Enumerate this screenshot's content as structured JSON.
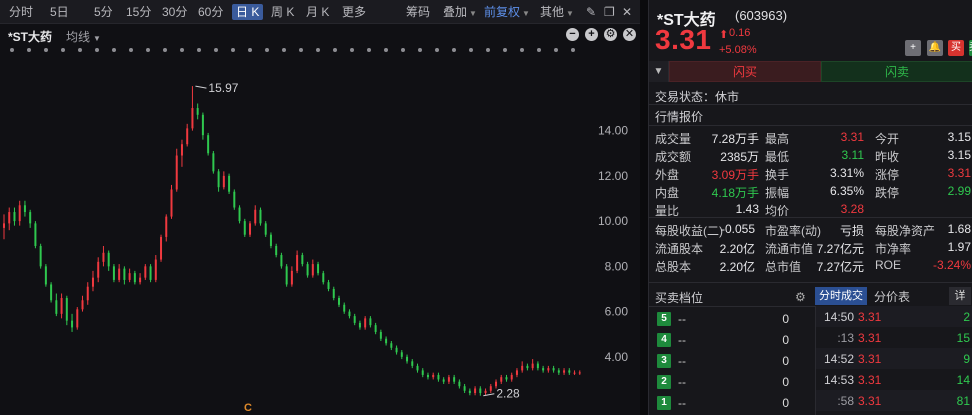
{
  "toolbar": {
    "periods": [
      "分时",
      "5日",
      "5分",
      "15分",
      "30分",
      "60分",
      "日 K",
      "周 K",
      "月 K",
      "更多"
    ],
    "active_period": "日 K",
    "tools": [
      "筹码",
      "叠加",
      "前复权",
      "其他"
    ]
  },
  "chart_header": {
    "title": "*ST大药",
    "ma_select": "均线"
  },
  "chart_data": {
    "type": "candlestick",
    "y_ticks": [
      "14.00",
      "12.00",
      "10.00",
      "8.00",
      "6.00",
      "4.00"
    ],
    "annotations": {
      "high": "15.97",
      "low": "2.28",
      "marker": "C"
    },
    "x_range": [
      0,
      111
    ],
    "ylim": [
      1.87,
      17.3
    ],
    "candles": [
      [
        9.7,
        9.9,
        10.3,
        9.2
      ],
      [
        9.9,
        10.4,
        10.6,
        9.6
      ],
      [
        10.4,
        10.0,
        10.6,
        9.8
      ],
      [
        10.0,
        10.7,
        10.9,
        9.8
      ],
      [
        10.7,
        10.4,
        10.9,
        10.2
      ],
      [
        10.4,
        9.9,
        10.5,
        9.7
      ],
      [
        9.9,
        8.9,
        10.0,
        8.8
      ],
      [
        8.9,
        8.0,
        9.0,
        7.9
      ],
      [
        8.0,
        7.2,
        8.1,
        7.1
      ],
      [
        7.2,
        6.5,
        7.3,
        6.4
      ],
      [
        6.5,
        5.9,
        6.8,
        5.8
      ],
      [
        5.9,
        6.6,
        6.8,
        5.7
      ],
      [
        6.6,
        5.6,
        6.7,
        5.4
      ],
      [
        5.6,
        5.3,
        5.9,
        5.1
      ],
      [
        5.3,
        6.1,
        6.2,
        5.2
      ],
      [
        6.1,
        6.5,
        6.7,
        6.0
      ],
      [
        6.5,
        7.1,
        7.3,
        6.3
      ],
      [
        7.1,
        7.5,
        7.8,
        6.9
      ],
      [
        7.5,
        8.2,
        8.4,
        7.3
      ],
      [
        8.2,
        8.6,
        8.9,
        8.0
      ],
      [
        8.6,
        8.0,
        8.7,
        7.8
      ],
      [
        8.0,
        7.4,
        8.1,
        7.3
      ],
      [
        7.4,
        7.9,
        8.1,
        7.3
      ],
      [
        7.9,
        7.4,
        8.0,
        7.2
      ],
      [
        7.4,
        7.7,
        7.9,
        7.3
      ],
      [
        7.7,
        7.3,
        7.8,
        7.2
      ],
      [
        7.3,
        7.5,
        7.7,
        7.2
      ],
      [
        7.5,
        8.0,
        8.1,
        7.4
      ],
      [
        8.0,
        7.4,
        8.1,
        7.3
      ],
      [
        7.4,
        8.3,
        8.5,
        7.3
      ],
      [
        8.3,
        9.3,
        9.4,
        8.2
      ],
      [
        9.3,
        10.2,
        10.3,
        9.1
      ],
      [
        10.2,
        11.4,
        11.6,
        10.1
      ],
      [
        11.4,
        12.9,
        13.2,
        11.3
      ],
      [
        12.9,
        13.4,
        13.6,
        12.4
      ],
      [
        13.4,
        14.1,
        14.3,
        13.3
      ],
      [
        14.1,
        15.0,
        15.97,
        14.0
      ],
      [
        15.0,
        14.7,
        15.2,
        14.5
      ],
      [
        14.7,
        13.8,
        14.8,
        13.6
      ],
      [
        13.8,
        13.0,
        13.9,
        12.9
      ],
      [
        13.0,
        12.2,
        13.1,
        12.1
      ],
      [
        12.2,
        11.5,
        12.3,
        11.3
      ],
      [
        11.5,
        12.0,
        12.2,
        11.4
      ],
      [
        12.0,
        11.3,
        12.1,
        11.2
      ],
      [
        11.3,
        10.6,
        11.4,
        10.5
      ],
      [
        10.6,
        10.0,
        10.7,
        9.9
      ],
      [
        10.0,
        9.4,
        10.1,
        9.3
      ],
      [
        9.4,
        9.9,
        10.0,
        9.3
      ],
      [
        9.9,
        10.5,
        10.7,
        9.8
      ],
      [
        10.5,
        9.9,
        10.6,
        9.8
      ],
      [
        9.9,
        9.4,
        10.0,
        9.3
      ],
      [
        9.4,
        8.9,
        9.5,
        8.8
      ],
      [
        8.9,
        8.5,
        9.0,
        8.4
      ],
      [
        8.5,
        8.0,
        8.6,
        7.9
      ],
      [
        8.0,
        7.2,
        8.1,
        7.1
      ],
      [
        7.2,
        7.8,
        8.0,
        7.1
      ],
      [
        7.8,
        8.5,
        8.7,
        7.7
      ],
      [
        8.5,
        8.1,
        8.6,
        8.0
      ],
      [
        8.1,
        7.6,
        8.2,
        7.5
      ],
      [
        7.6,
        8.1,
        8.3,
        7.5
      ],
      [
        8.1,
        7.7,
        8.2,
        7.6
      ],
      [
        7.7,
        7.3,
        7.8,
        7.2
      ],
      [
        7.3,
        7.0,
        7.4,
        6.9
      ],
      [
        7.0,
        6.6,
        7.1,
        6.5
      ],
      [
        6.6,
        6.3,
        6.7,
        6.2
      ],
      [
        6.3,
        6.0,
        6.4,
        5.9
      ],
      [
        6.0,
        5.8,
        6.1,
        5.7
      ],
      [
        5.8,
        5.5,
        5.9,
        5.4
      ],
      [
        5.5,
        5.3,
        5.6,
        5.2
      ],
      [
        5.3,
        5.7,
        5.8,
        5.2
      ],
      [
        5.7,
        5.4,
        5.8,
        5.3
      ],
      [
        5.4,
        5.1,
        5.5,
        5.0
      ],
      [
        5.1,
        4.8,
        5.2,
        4.7
      ],
      [
        4.8,
        4.6,
        4.9,
        4.5
      ],
      [
        4.6,
        4.4,
        4.7,
        4.3
      ],
      [
        4.4,
        4.2,
        4.5,
        4.1
      ],
      [
        4.2,
        4.0,
        4.3,
        3.9
      ],
      [
        4.0,
        3.8,
        4.1,
        3.7
      ],
      [
        3.8,
        3.6,
        3.9,
        3.5
      ],
      [
        3.6,
        3.4,
        3.7,
        3.3
      ],
      [
        3.4,
        3.2,
        3.5,
        3.1
      ],
      [
        3.2,
        3.1,
        3.3,
        3.0
      ],
      [
        3.1,
        3.2,
        3.3,
        3.0
      ],
      [
        3.2,
        3.0,
        3.3,
        2.9
      ],
      [
        3.0,
        2.9,
        3.1,
        2.8
      ],
      [
        2.9,
        3.1,
        3.2,
        2.8
      ],
      [
        3.1,
        2.9,
        3.2,
        2.8
      ],
      [
        2.9,
        2.7,
        3.0,
        2.6
      ],
      [
        2.7,
        2.5,
        2.8,
        2.4
      ],
      [
        2.5,
        2.4,
        2.6,
        2.3
      ],
      [
        2.4,
        2.6,
        2.7,
        2.3
      ],
      [
        2.6,
        2.4,
        2.7,
        2.28
      ],
      [
        2.4,
        2.5,
        2.6,
        2.3
      ],
      [
        2.5,
        2.7,
        2.8,
        2.4
      ],
      [
        2.7,
        2.9,
        3.0,
        2.6
      ],
      [
        2.9,
        3.1,
        3.2,
        2.8
      ],
      [
        3.1,
        3.0,
        3.2,
        2.9
      ],
      [
        3.0,
        3.2,
        3.3,
        2.9
      ],
      [
        3.2,
        3.4,
        3.5,
        3.1
      ],
      [
        3.4,
        3.6,
        3.8,
        3.3
      ],
      [
        3.6,
        3.5,
        3.7,
        3.4
      ],
      [
        3.5,
        3.7,
        3.9,
        3.4
      ],
      [
        3.7,
        3.5,
        3.8,
        3.4
      ],
      [
        3.5,
        3.4,
        3.6,
        3.3
      ],
      [
        3.4,
        3.5,
        3.6,
        3.3
      ],
      [
        3.5,
        3.4,
        3.6,
        3.3
      ],
      [
        3.4,
        3.3,
        3.5,
        3.2
      ],
      [
        3.3,
        3.4,
        3.5,
        3.2
      ],
      [
        3.4,
        3.3,
        3.5,
        3.2
      ],
      [
        3.3,
        3.3,
        3.4,
        3.2
      ],
      [
        3.3,
        3.31,
        3.4,
        3.2
      ]
    ]
  },
  "quote": {
    "name": "*ST大药",
    "code": "(603963)",
    "price": "3.31",
    "change": "0.16",
    "change_pct": "+5.08%",
    "arrow": "⬆",
    "buttons": [
      "+",
      "🔔",
      "买",
      "卖"
    ],
    "flash_buy": "闪买",
    "flash_sell": "闪卖",
    "trade_status": "交易状态：休市",
    "section_title": "行情报价",
    "rows": [
      [
        "成交量",
        "7.28万手",
        "最高",
        "3.31",
        "今开",
        "3.15"
      ],
      [
        "成交额",
        "2385万",
        "最低",
        "3.11",
        "昨收",
        "3.15"
      ],
      [
        "外盘",
        "3.09万手",
        "换手",
        "3.31%",
        "涨停",
        "3.31"
      ],
      [
        "内盘",
        "4.18万手",
        "振幅",
        "6.35%",
        "跌停",
        "2.99"
      ],
      [
        "量比",
        "1.43",
        "均价",
        "3.28",
        "",
        ""
      ]
    ],
    "rows2": [
      [
        "每股收益(二)",
        "-0.055",
        "市盈率(动)",
        "亏损",
        "每股净资产",
        "1.68"
      ],
      [
        "流通股本",
        "2.20亿",
        "流通市值",
        "7.27亿元",
        "市净率",
        "1.97"
      ],
      [
        "总股本",
        "2.20亿",
        "总市值",
        "7.27亿元",
        "ROE",
        "-3.24%"
      ]
    ]
  },
  "order_book": {
    "title": "买卖档位",
    "levels": [
      {
        "level": "5",
        "price": "--",
        "vol": "0"
      },
      {
        "level": "4",
        "price": "--",
        "vol": "0"
      },
      {
        "level": "3",
        "price": "--",
        "vol": "0"
      },
      {
        "level": "2",
        "price": "--",
        "vol": "0"
      },
      {
        "level": "1",
        "price": "--",
        "vol": "0"
      }
    ]
  },
  "ticks_panel": {
    "tab_ticks": "分时成交",
    "tab_price": "分价表",
    "tab_detail": "详",
    "ticks": [
      {
        "time": "14:50",
        "price": "3.31",
        "vol": "2",
        "side": "buy"
      },
      {
        "time": ":13",
        "price": "3.31",
        "vol": "15",
        "side": "buy"
      },
      {
        "time": "14:52",
        "price": "3.31",
        "vol": "9",
        "side": "buy"
      },
      {
        "time": "14:53",
        "price": "3.31",
        "vol": "14",
        "side": "buy"
      },
      {
        "time": ":58",
        "price": "3.31",
        "vol": "81",
        "side": "buy"
      }
    ]
  },
  "colors": {
    "up": "#f0393f",
    "down": "#2fc84f",
    "accent": "#3a5b9c"
  }
}
